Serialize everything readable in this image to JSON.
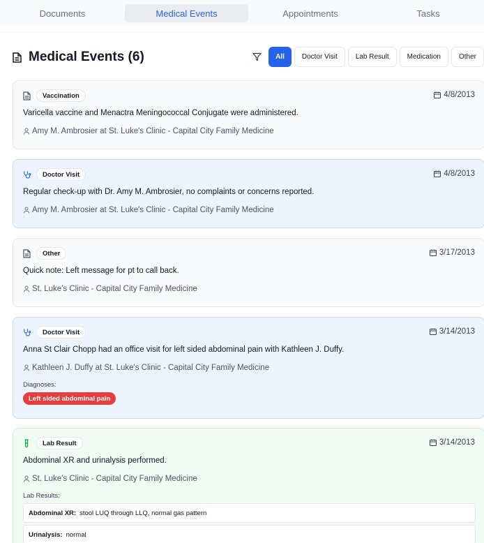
{
  "tabs": [
    {
      "label": "Documents"
    },
    {
      "label": "Medical Events"
    },
    {
      "label": "Appointments"
    },
    {
      "label": "Tasks"
    }
  ],
  "header": {
    "title": "Medical Events (6)",
    "icon": "document-icon"
  },
  "filters": [
    {
      "label": "All",
      "active": true
    },
    {
      "label": "Doctor Visit"
    },
    {
      "label": "Lab Result"
    },
    {
      "label": "Medication"
    },
    {
      "label": "Other"
    }
  ],
  "events": [
    {
      "type": "Vaccination",
      "icon": "document-icon",
      "date": "4/8/2013",
      "description": "Varicella vaccine and Menactra Meningococcal Conjugate were administered.",
      "provider": "Amy M. Ambrosier at St. Luke's Clinic - Capital City Family Medicine"
    },
    {
      "type": "Doctor Visit",
      "icon": "stethoscope-icon",
      "date": "4/8/2013",
      "description": "Regular check-up with Dr. Amy M. Ambrosier, no complaints or concerns reported.",
      "provider": "Amy M. Ambrosier at St. Luke's Clinic - Capital City Family Medicine"
    },
    {
      "type": "Other",
      "icon": "document-icon",
      "date": "3/17/2013",
      "description": "Quick note: Left message for pt to call back.",
      "provider": "St. Luke's Clinic - Capital City Family Medicine"
    },
    {
      "type": "Doctor Visit",
      "icon": "stethoscope-icon",
      "date": "3/14/2013",
      "description": "Anna St Clair Chopp had an office visit for left sided abdominal pain with Kathleen J. Duffy.",
      "provider": "Kathleen J. Duffy at St. Luke's Clinic - Capital City Family Medicine",
      "diagnoses_label": "Diagnoses:",
      "diagnoses": [
        "Left sided abdominal pain"
      ]
    },
    {
      "type": "Lab Result",
      "icon": "test-tube-icon",
      "date": "3/14/2013",
      "description": "Abdominal XR and urinalysis performed.",
      "provider": "St. Luke's Clinic - Capital City Family Medicine",
      "lab_label": "Lab Results:",
      "lab_results": [
        {
          "name": "Abdominal XR:",
          "value": "stool LUQ through LLQ, normal gas pattern"
        },
        {
          "name": "Urinalysis:",
          "value": "normal"
        }
      ]
    }
  ],
  "colors": {
    "accent": "#2563eb",
    "diagnosis": "#e53e3e",
    "visit_bg": "#eef4fd",
    "lab_bg": "#effbf3"
  }
}
